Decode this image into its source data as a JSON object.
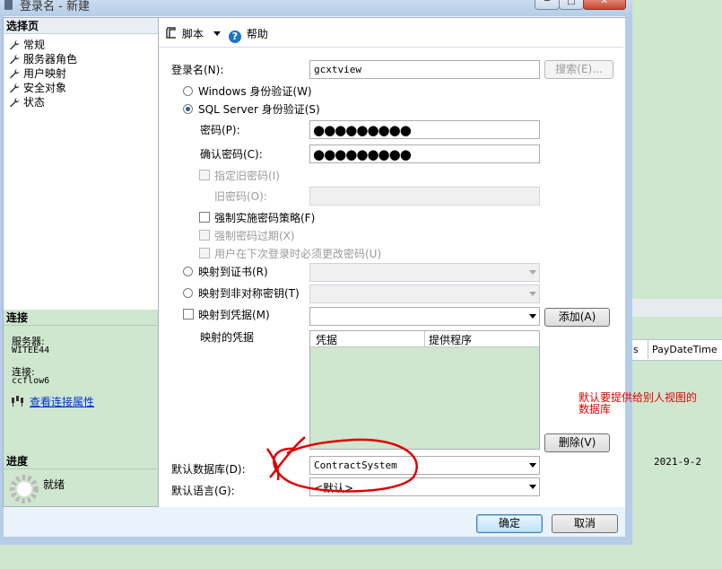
{
  "window": {
    "title": "登录名 - 新建",
    "minimize_label": "─",
    "maximize_label": "□",
    "close_label": "✕"
  },
  "left_panel": {
    "select_page_header": "选择页",
    "pages": [
      {
        "label": "常规",
        "icon": "wrench-icon"
      },
      {
        "label": "服务器角色",
        "icon": "wrench-icon"
      },
      {
        "label": "用户映射",
        "icon": "wrench-icon"
      },
      {
        "label": "安全对象",
        "icon": "wrench-icon"
      },
      {
        "label": "状态",
        "icon": "wrench-icon"
      }
    ],
    "connection_header": "连接",
    "server_label": "服务器:",
    "server_value": "WITEE44",
    "connection_label": "连接:",
    "connection_value": "ccflow6",
    "view_properties_link": "查看连接属性",
    "progress_header": "进度",
    "progress_status": "就绪"
  },
  "toolbar": {
    "script_label": "脚本",
    "help_label": "帮助"
  },
  "form": {
    "login_name_label": "登录名(N):",
    "login_name_value": "gcxtview",
    "search_button": "搜索(E)...",
    "windows_auth_label": "Windows 身份验证(W)",
    "sql_auth_label": "SQL Server 身份验证(S)",
    "password_label": "密码(P):",
    "password_mask": "●●●●●●●●●",
    "confirm_password_label": "确认密码(C):",
    "confirm_password_mask": "●●●●●●●●●",
    "specify_old_password_label": "指定旧密码(I)",
    "old_password_label": "旧密码(O):",
    "enforce_policy_label": "强制实施密码策略(F)",
    "enforce_expiration_label": "强制密码过期(X)",
    "must_change_label": "用户在下次登录时必须更改密码(U)",
    "map_certificate_label": "映射到证书(R)",
    "map_asymmetric_key_label": "映射到非对称密钥(T)",
    "map_credential_label": "映射到凭据(M)",
    "add_button": "添加(A)",
    "mapped_credentials_label": "映射的凭据",
    "grid_columns": [
      "凭据",
      "提供程序"
    ],
    "remove_button": "删除(V)",
    "default_database_label": "默认数据库(D):",
    "default_database_value": "ContractSystem",
    "default_language_label": "默认语言(G):",
    "default_language_value": "<默认>"
  },
  "footer": {
    "ok_button": "确定",
    "cancel_button": "取消"
  },
  "background_app": {
    "column_s": "s",
    "column_paydatetime": "PayDateTime",
    "cell_date": "2021-9-2"
  },
  "annotation": {
    "text_line1": "默认要提供给别人视图的",
    "text_line2": "数据库",
    "color": "#e00000"
  }
}
